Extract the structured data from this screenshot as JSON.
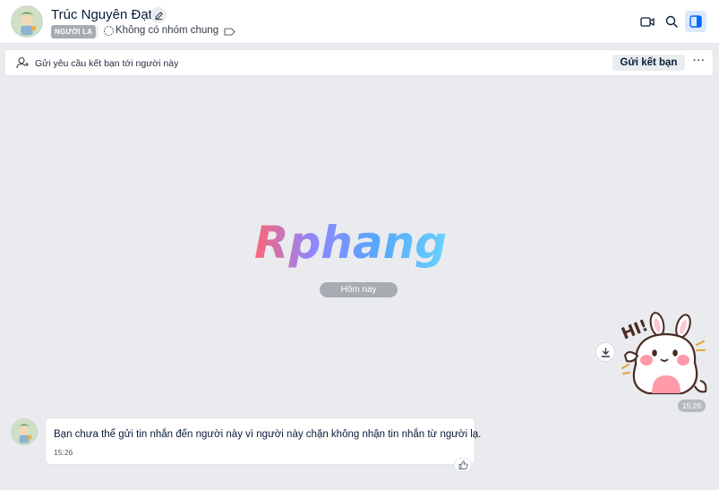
{
  "header": {
    "contact_name": "Trúc Nguyên Đạt",
    "badge": "NGƯỜI LẠ",
    "group_status": "Không có nhóm chung",
    "icons": [
      "edit-icon",
      "group-icon",
      "tag-icon",
      "video-call-icon",
      "search-icon",
      "side-panel-icon"
    ]
  },
  "request_bar": {
    "text": "Gửi yêu cầu kết bạn tới người này",
    "button_label": "Gửi kết bạn",
    "more_label": "···"
  },
  "watermark": {
    "text": "Rphang"
  },
  "conversation": {
    "date_divider": "Hôm nay",
    "sticker": {
      "caption": "HI!",
      "time": "15:26"
    },
    "incoming_message": {
      "text": "Bạn chưa thể gửi tin nhắn đến người này vì người này chặn không nhận tin nhắn từ người lạ.",
      "time": "15:26"
    }
  },
  "colors": {
    "chat_background": "#e9ebee",
    "accent": "#0068ff",
    "panel_active_bg": "#dbe9ff",
    "badge_bg": "#a7acb3"
  }
}
